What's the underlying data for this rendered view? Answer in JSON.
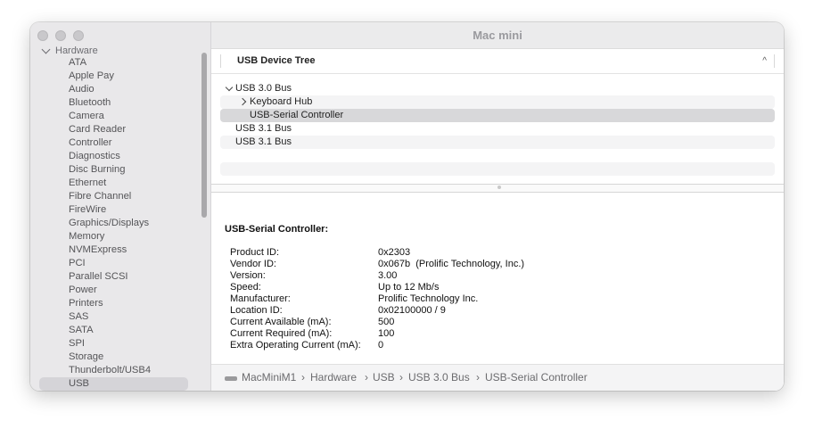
{
  "window": {
    "title": "Mac mini"
  },
  "sidebar": {
    "group": "Hardware",
    "items": [
      "ATA",
      "Apple Pay",
      "Audio",
      "Bluetooth",
      "Camera",
      "Card Reader",
      "Controller",
      "Diagnostics",
      "Disc Burning",
      "Ethernet",
      "Fibre Channel",
      "FireWire",
      "Graphics/Displays",
      "Memory",
      "NVMExpress",
      "PCI",
      "Parallel SCSI",
      "Power",
      "Printers",
      "SAS",
      "SATA",
      "SPI",
      "Storage",
      "Thunderbolt/USB4",
      "USB"
    ],
    "selected": "USB"
  },
  "tree": {
    "header": "USB Device Tree",
    "sort_glyph": "^",
    "rows": [
      {
        "label": "USB 3.0 Bus"
      },
      {
        "label": "Keyboard Hub"
      },
      {
        "label": "USB-Serial Controller"
      },
      {
        "label": "USB 3.1 Bus"
      },
      {
        "label": "USB 3.1 Bus"
      }
    ]
  },
  "detail": {
    "title": "USB-Serial Controller:",
    "fields": [
      {
        "key": "Product ID:",
        "value": "0x2303"
      },
      {
        "key": "Vendor ID:",
        "value": "0x067b  (Prolific Technology, Inc.)"
      },
      {
        "key": "Version:",
        "value": "3.00"
      },
      {
        "key": "Speed:",
        "value": "Up to 12 Mb/s"
      },
      {
        "key": "Manufacturer:",
        "value": "Prolific Technology Inc."
      },
      {
        "key": "Location ID:",
        "value": "0x02100000 / 9"
      },
      {
        "key": "Current Available (mA):",
        "value": "500"
      },
      {
        "key": "Current Required (mA):",
        "value": "100"
      },
      {
        "key": "Extra Operating Current (mA):",
        "value": "0"
      }
    ]
  },
  "pathbar": {
    "icon": "mac-mini-icon",
    "crumbs": [
      "MacMiniM1",
      "Hardware",
      "USB",
      "USB 3.0 Bus",
      "USB-Serial Controller"
    ]
  }
}
